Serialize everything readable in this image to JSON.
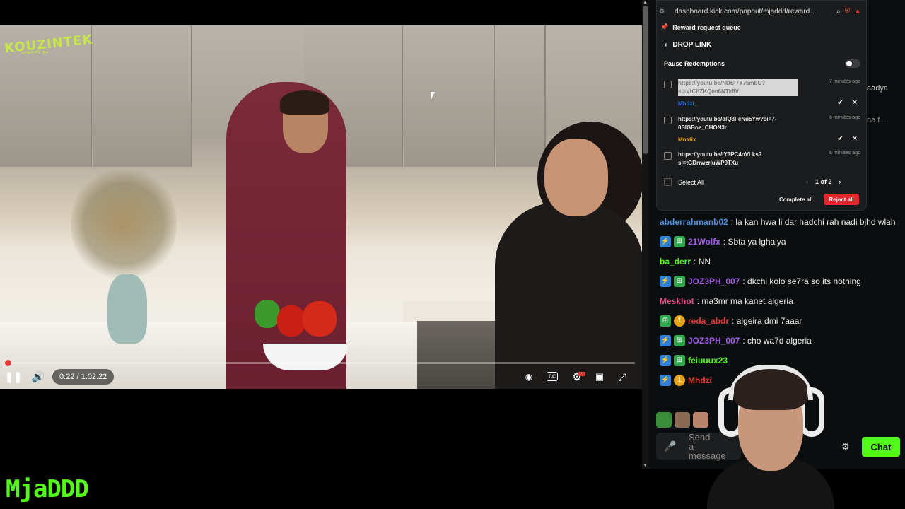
{
  "video": {
    "channel_logo": "KOUZINTEK",
    "logo_subtitle": "مع ناجحوتي",
    "time": "0:22 / 1:02:22",
    "progress_fraction": 0.0035
  },
  "streamer": {
    "name": "MjaDDD"
  },
  "browser": {
    "url": "dashboard.kick.com/popout/mjaddd/reward..."
  },
  "reward_queue": {
    "header": "Reward request queue",
    "reward_name": "DROP LINK",
    "pause_label": "Pause Redemptions",
    "requests": [
      {
        "link": "https://youtu.be/NDSf7Y75mbU?si=VtCffZKQeo6NTk8V",
        "ago": "7 minutes ago",
        "user": "Mhdzi_",
        "user_color": "#2f7fd6",
        "selected": true
      },
      {
        "link": "https://youtu.be/dlQ3FeNu5Yw?si=7-0SlGBoe_CHON3r",
        "ago": "6 minutes ago",
        "user": "Mnatix",
        "user_color": "#e8a317",
        "selected": false
      },
      {
        "link": "https://youtu.be/lY3PC4oVLks?si=tGDrrwzrluWP9TXu",
        "ago": "6 minutes ago",
        "user": "",
        "user_color": "#ffffff",
        "selected": false
      }
    ],
    "select_all": "Select All",
    "page": "1 of 2",
    "complete_all": "Complete all",
    "reject_all": "Reject all"
  },
  "behind_text": {
    "a": "aadya",
    "b": "na f ..."
  },
  "chat": {
    "messages": [
      {
        "user": "abderrahmanb02",
        "color": "#4e8fe0",
        "text": ": la kan hwa li dar hadchi rah nadi bjhd wlah",
        "badges": []
      },
      {
        "user": "21Wolfx",
        "color": "#a55ef0",
        "text": ": Sbta ya lghalya",
        "badges": [
          "blue",
          "green"
        ]
      },
      {
        "user": "ba_derr",
        "color": "#53fc18",
        "text": ": NN",
        "badges": []
      },
      {
        "user": "JOZ3PH_007",
        "color": "#a55ef0",
        "text": ": dkchi kolo se7ra so its nothing",
        "badges": [
          "blue",
          "green"
        ]
      },
      {
        "user": "Meskhot",
        "color": "#e94f8a",
        "text": ": ma3mr ma kanet algeria",
        "badges": []
      },
      {
        "user": "reda_abdr",
        "color": "#e53935",
        "text": ": algeira dmi 7aaar",
        "badges": [
          "green",
          "gold"
        ]
      },
      {
        "user": "JOZ3PH_007",
        "color": "#a55ef0",
        "text": ": cho wa7d algeria",
        "badges": [
          "blue",
          "green"
        ]
      },
      {
        "user": "feiuuux23",
        "color": "#53fc18",
        "text": "",
        "badges": [
          "blue",
          "green"
        ]
      },
      {
        "user": "Mhdzi",
        "color": "#e53935",
        "text": "",
        "badges": [
          "blue",
          "gold"
        ]
      }
    ],
    "input_placeholder": "Send a message",
    "send_label": "Chat"
  },
  "colors": {
    "kick_green": "#53fc18",
    "reject_red": "#e5252c"
  }
}
